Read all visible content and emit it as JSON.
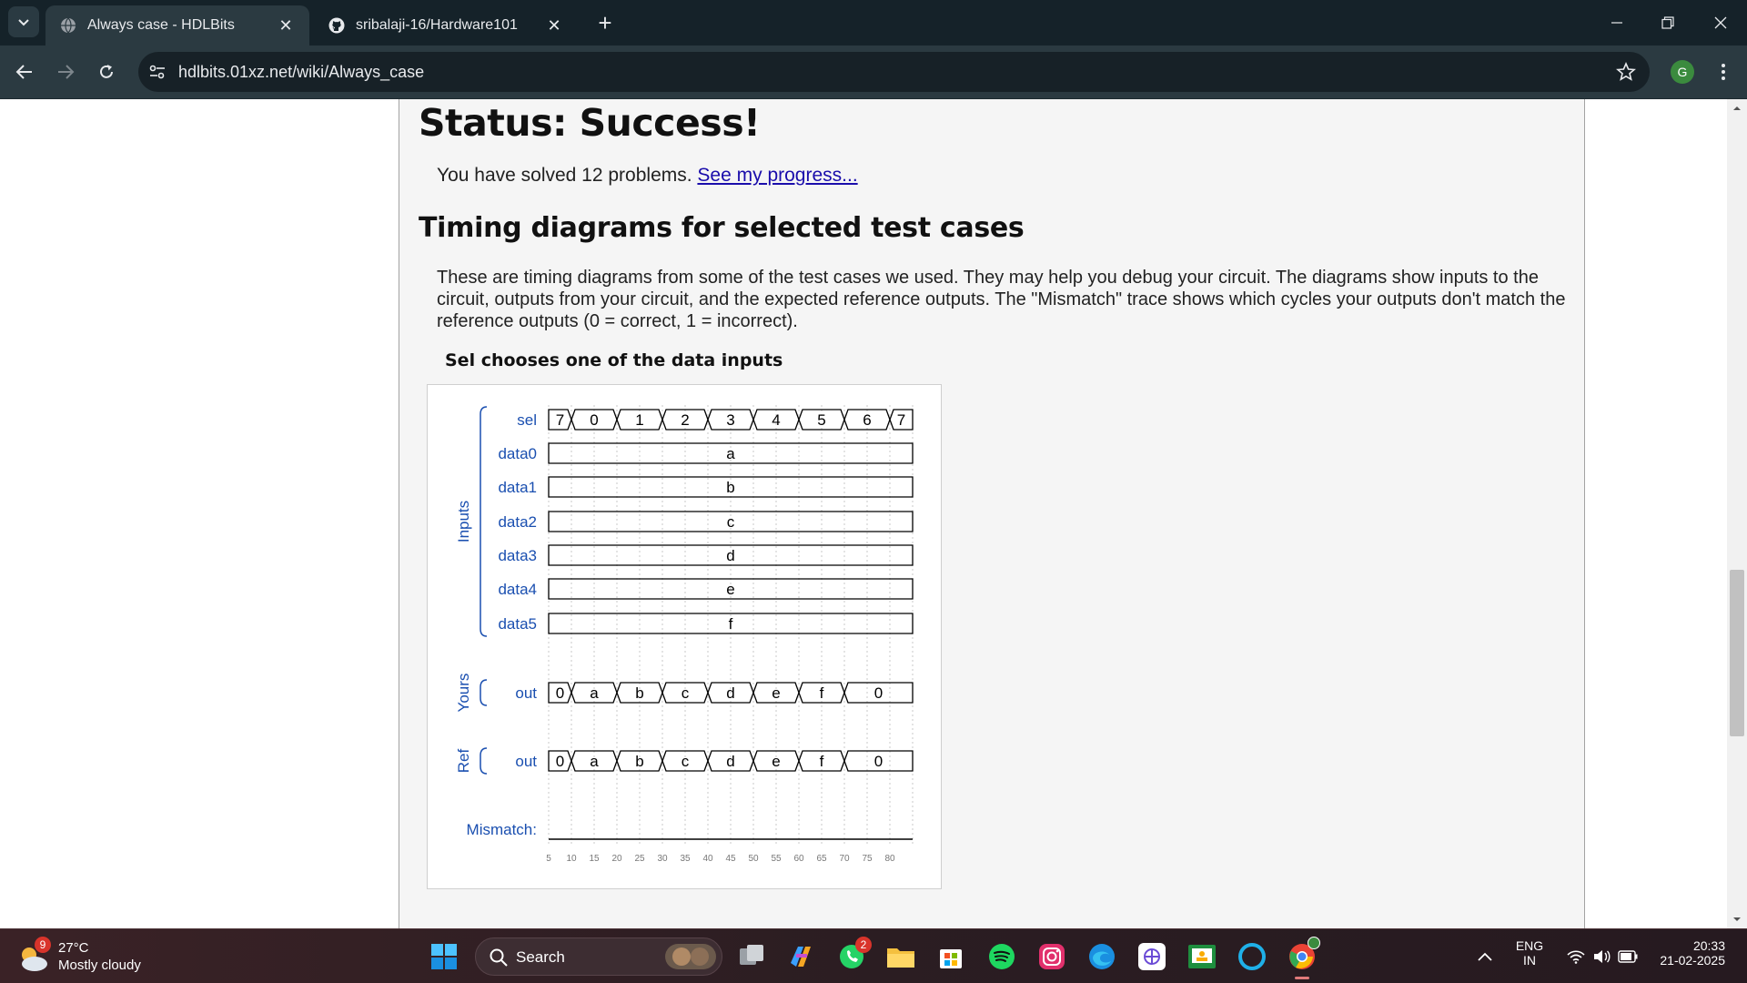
{
  "browser": {
    "tabs": [
      {
        "title": "Always case - HDLBits",
        "active": true,
        "icon": "globe-icon"
      },
      {
        "title": "sribalaji-16/Hardware101",
        "active": false,
        "icon": "github-icon"
      }
    ],
    "url": "hdlbits.01xz.net/wiki/Always_case",
    "profile_initial": "G"
  },
  "page": {
    "status_heading": "Status: Success!",
    "solved_text": "You have solved 12 problems.",
    "progress_link": "See my progress...",
    "timing_heading": "Timing diagrams for selected test cases",
    "description": "These are timing diagrams from some of the test cases we used. They may help you debug your circuit. The diagrams show inputs to the circuit, outputs from your circuit, and the expected reference outputs. The \"Mismatch\" trace shows which cycles your outputs don't match the reference outputs (0 = correct, 1 = incorrect).",
    "diagram_caption": "Sel chooses one of the data inputs"
  },
  "timing": {
    "time_ticks": [
      "5",
      "10",
      "15",
      "20",
      "25",
      "30",
      "35",
      "40",
      "45",
      "50",
      "55",
      "60",
      "65",
      "70",
      "75",
      "80"
    ],
    "groups": [
      {
        "label": "Inputs",
        "first": 0,
        "last": 6
      },
      {
        "label": "Yours",
        "first": 7,
        "last": 7
      },
      {
        "label": "Ref",
        "first": 8,
        "last": 8
      }
    ],
    "signals": [
      {
        "name": "sel",
        "type": "bus",
        "segments": [
          {
            "v": "7",
            "from": 5,
            "to": 10
          },
          {
            "v": "0",
            "from": 10,
            "to": 20
          },
          {
            "v": "1",
            "from": 20,
            "to": 30
          },
          {
            "v": "2",
            "from": 30,
            "to": 40
          },
          {
            "v": "3",
            "from": 40,
            "to": 50
          },
          {
            "v": "4",
            "from": 50,
            "to": 60
          },
          {
            "v": "5",
            "from": 60,
            "to": 70
          },
          {
            "v": "6",
            "from": 70,
            "to": 80
          },
          {
            "v": "7",
            "from": 80,
            "to": 85
          }
        ]
      },
      {
        "name": "data0",
        "type": "bus",
        "segments": [
          {
            "v": "a",
            "from": 5,
            "to": 85
          }
        ]
      },
      {
        "name": "data1",
        "type": "bus",
        "segments": [
          {
            "v": "b",
            "from": 5,
            "to": 85
          }
        ]
      },
      {
        "name": "data2",
        "type": "bus",
        "segments": [
          {
            "v": "c",
            "from": 5,
            "to": 85
          }
        ]
      },
      {
        "name": "data3",
        "type": "bus",
        "segments": [
          {
            "v": "d",
            "from": 5,
            "to": 85
          }
        ]
      },
      {
        "name": "data4",
        "type": "bus",
        "segments": [
          {
            "v": "e",
            "from": 5,
            "to": 85
          }
        ]
      },
      {
        "name": "data5",
        "type": "bus",
        "segments": [
          {
            "v": "f",
            "from": 5,
            "to": 85
          }
        ]
      },
      {
        "name": "out",
        "type": "bus",
        "segments": [
          {
            "v": "0",
            "from": 5,
            "to": 10
          },
          {
            "v": "a",
            "from": 10,
            "to": 20
          },
          {
            "v": "b",
            "from": 20,
            "to": 30
          },
          {
            "v": "c",
            "from": 30,
            "to": 40
          },
          {
            "v": "d",
            "from": 40,
            "to": 50
          },
          {
            "v": "e",
            "from": 50,
            "to": 60
          },
          {
            "v": "f",
            "from": 60,
            "to": 70
          },
          {
            "v": "0",
            "from": 70,
            "to": 85
          }
        ]
      },
      {
        "name": "out",
        "type": "bus",
        "segments": [
          {
            "v": "0",
            "from": 5,
            "to": 10
          },
          {
            "v": "a",
            "from": 10,
            "to": 20
          },
          {
            "v": "b",
            "from": 20,
            "to": 30
          },
          {
            "v": "c",
            "from": 30,
            "to": 40
          },
          {
            "v": "d",
            "from": 40,
            "to": 50
          },
          {
            "v": "e",
            "from": 50,
            "to": 60
          },
          {
            "v": "f",
            "from": 60,
            "to": 70
          },
          {
            "v": "0",
            "from": 70,
            "to": 85
          }
        ]
      },
      {
        "name": "Mismatch:",
        "type": "bit",
        "value": 0
      }
    ],
    "colors": {
      "label": "#1a4fb0",
      "trace": "#000000",
      "grid": "#c8c8c8"
    }
  },
  "taskbar": {
    "weather": {
      "temp": "27°C",
      "condition": "Mostly cloudy",
      "badge": "9"
    },
    "search_label": "Search",
    "whatsapp_badge": "2",
    "lang_line1": "ENG",
    "lang_line2": "IN",
    "time": "20:33",
    "date": "21-02-2025"
  }
}
